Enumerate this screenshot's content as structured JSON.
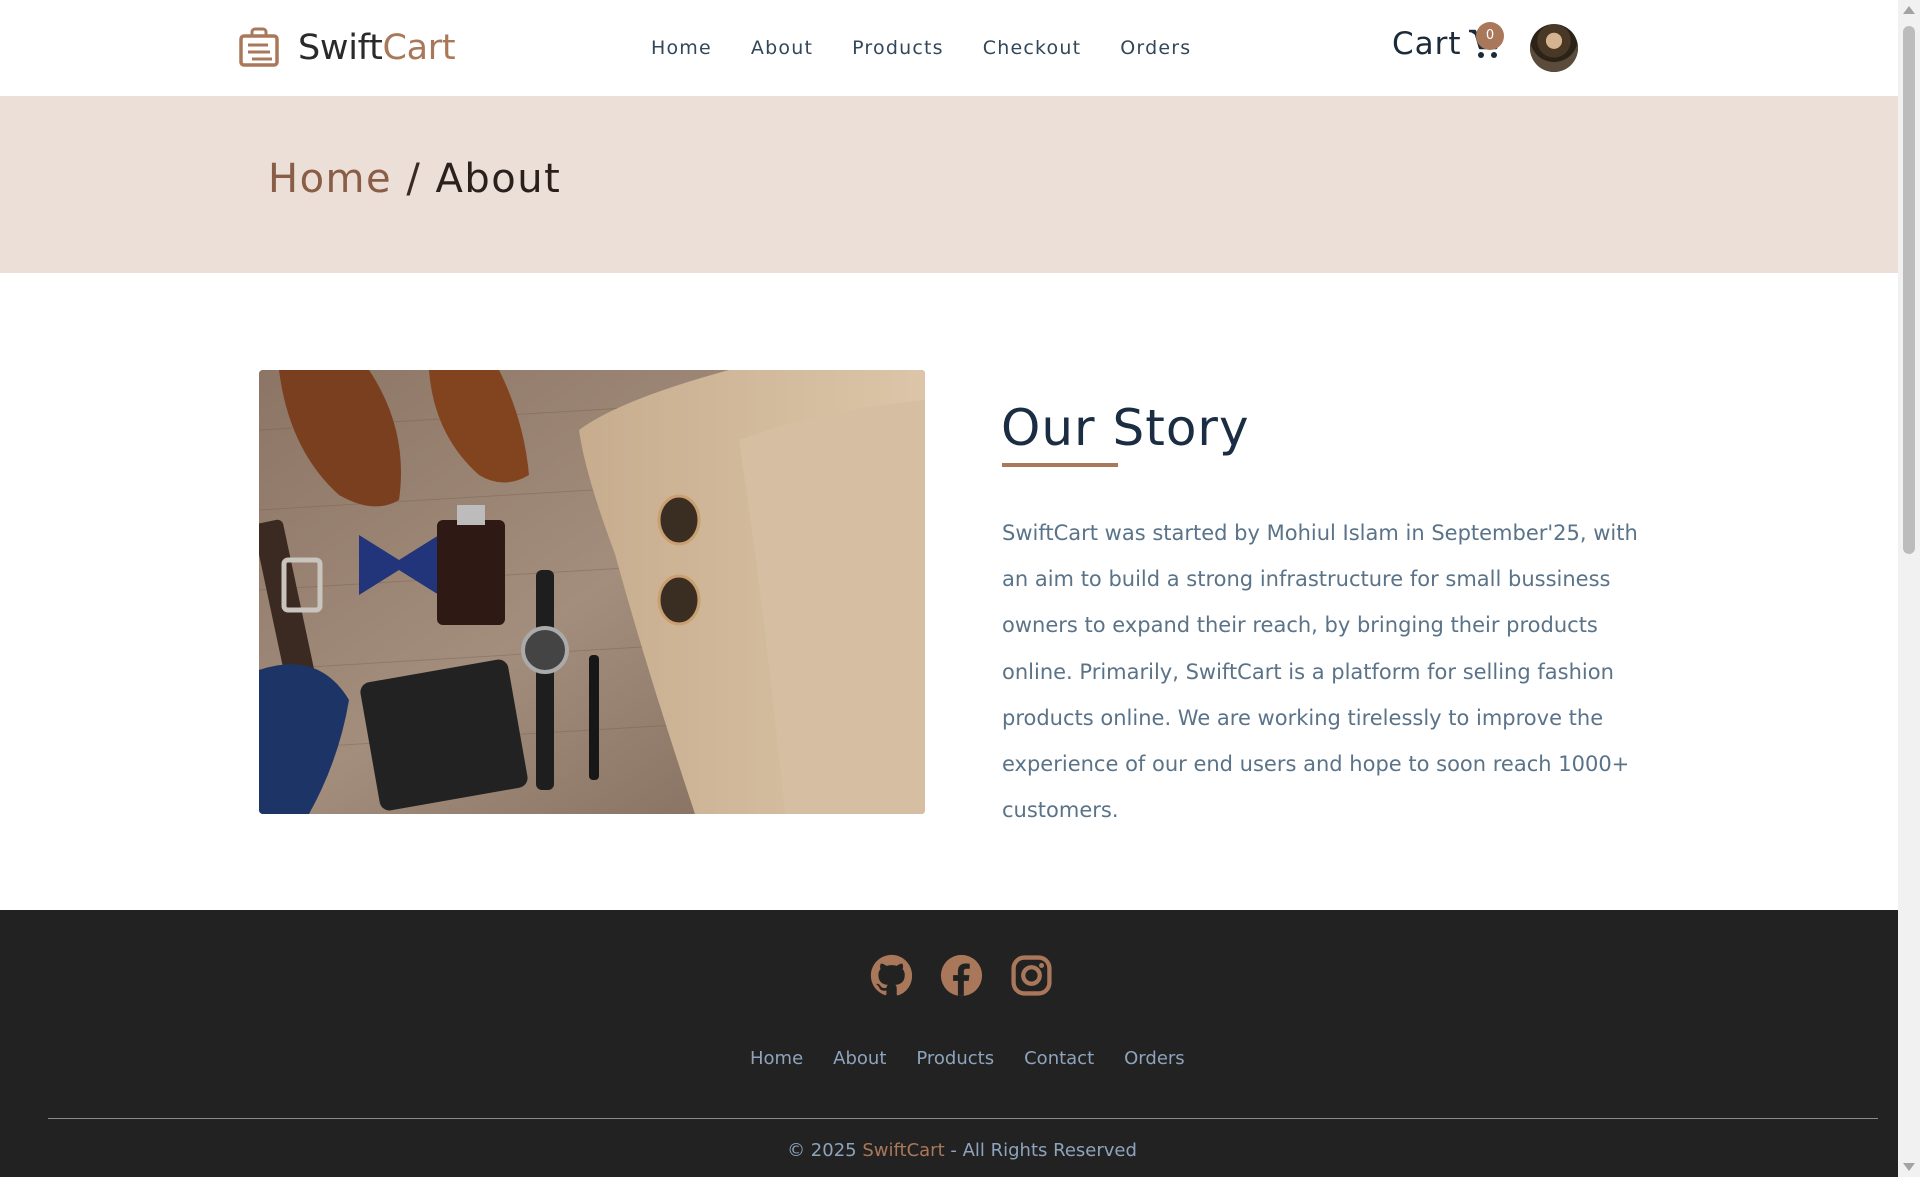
{
  "brand": {
    "name_part1": "Swift",
    "name_part2": "Cart",
    "accent_color": "#a9785a"
  },
  "nav": {
    "links": [
      {
        "label": "Home"
      },
      {
        "label": "About"
      },
      {
        "label": "Products"
      },
      {
        "label": "Checkout"
      },
      {
        "label": "Orders"
      }
    ]
  },
  "cart": {
    "label": "Cart",
    "count": "0",
    "icon": "shopping-cart-icon"
  },
  "user": {
    "avatar": "user-avatar"
  },
  "breadcrumb": {
    "home": "Home",
    "separator": "/",
    "current": "About"
  },
  "story": {
    "title": "Our Story",
    "body": "SwiftCart was started by Mohiul Islam in September'25, with an aim to build a strong infrastructure for small bussiness owners to expand their reach, by bringing their products online. Primarily, SwiftCart is a platform for selling fashion products online. We are working tirelessly to improve the experience of our end users and hope to soon reach 1000+ customers.",
    "image": "flat-lay of men's fashion accessories: shoes, belt, bow tie, perfume, wallet, watch, pen, sunglasses, chinos, socks"
  },
  "footer": {
    "socials": [
      {
        "icon": "github-icon"
      },
      {
        "icon": "facebook-icon"
      },
      {
        "icon": "instagram-icon"
      }
    ],
    "links": [
      {
        "label": "Home"
      },
      {
        "label": "About"
      },
      {
        "label": "Products"
      },
      {
        "label": "Contact"
      },
      {
        "label": "Orders"
      }
    ],
    "copyright_prefix": "© 2025 ",
    "copyright_brand": "SwiftCart",
    "copyright_suffix": " - All Rights Reserved"
  },
  "colors": {
    "banner_bg": "#ebdfd8",
    "footer_bg": "#222222",
    "heading": "#1b2d42",
    "body_text": "#5a7388",
    "footer_text": "#8ea4bc"
  }
}
